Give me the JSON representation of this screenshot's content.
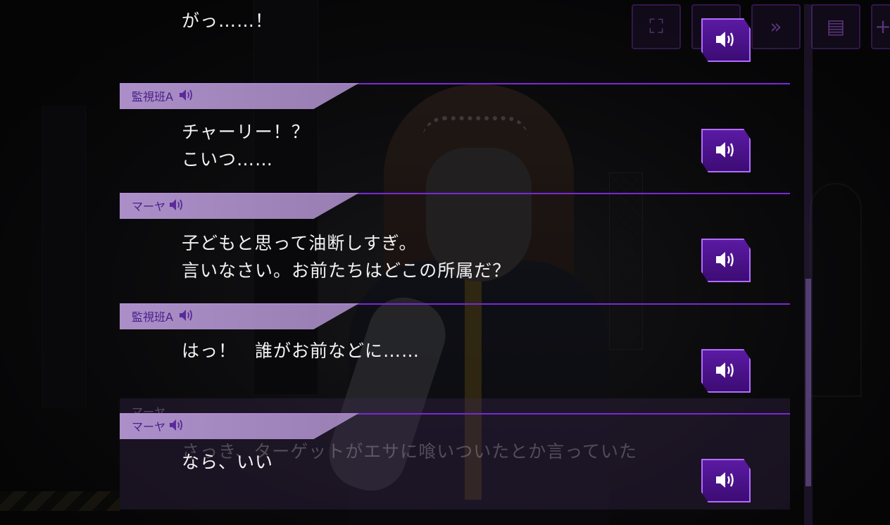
{
  "colors": {
    "accent": "#7a28d8",
    "tab_bg": "#b496d2",
    "name_text": "#4a1f8a",
    "voice_bg": "#5b1aa3"
  },
  "toolbar": [
    {
      "icon": "close-log-icon",
      "glyph": "⛶"
    },
    {
      "icon": "voice-icon",
      "glyph": ""
    },
    {
      "icon": "skip-icon",
      "glyph": "»"
    },
    {
      "icon": "document-icon",
      "glyph": "▤"
    },
    {
      "icon": "menu-icon",
      "glyph": "+"
    }
  ],
  "entries": [
    {
      "speaker": "",
      "lines": [
        "がっ……！"
      ]
    },
    {
      "speaker": "監視班A",
      "lines": [
        "チャーリー！？",
        "こいつ……"
      ]
    },
    {
      "speaker": "マーヤ",
      "lines": [
        "子どもと思って油断しすぎ。",
        "言いなさい。お前たちはどこの所属だ？"
      ]
    },
    {
      "speaker": "監視班A",
      "lines": [
        "はっ！　誰がお前などに……"
      ]
    },
    {
      "speaker": "マーヤ",
      "lines": [
        "なら、いい"
      ]
    }
  ],
  "ghost": {
    "speaker": "マーヤ",
    "line": "さっき、ターゲットがエサに喰いついたとか言っていた"
  }
}
